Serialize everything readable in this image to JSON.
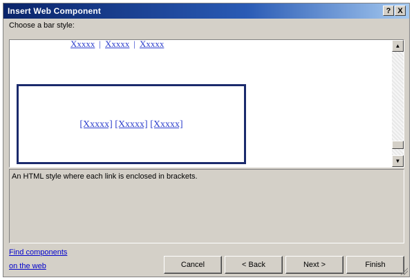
{
  "window": {
    "title": "Insert Web Component",
    "help_label": "?",
    "close_label": "X"
  },
  "bar_style_label": "Choose a bar style:",
  "preview": {
    "pipe_style_items": [
      "Xxxxx",
      "Xxxxx",
      "Xxxxx"
    ],
    "pipe_separator": "|",
    "bracket_style_items": [
      "[Xxxxx]",
      "[Xxxxx]",
      "[Xxxxx]"
    ]
  },
  "description": "An HTML style where each link is enclosed in brackets.",
  "links": {
    "find_line1": "Find components",
    "find_line2": "on the web"
  },
  "buttons": {
    "cancel": "Cancel",
    "back": "< Back",
    "next": "Next >",
    "finish": "Finish"
  },
  "colors": {
    "titlebar": "#0a246a",
    "link": "#2c3ecc",
    "selection_border": "#1a2a6c",
    "dialog_bg": "#d4d0c8"
  },
  "icons": {
    "scroll_up": "triangle-up-icon",
    "scroll_down": "triangle-down-icon",
    "resize": "resize-grip-icon"
  }
}
